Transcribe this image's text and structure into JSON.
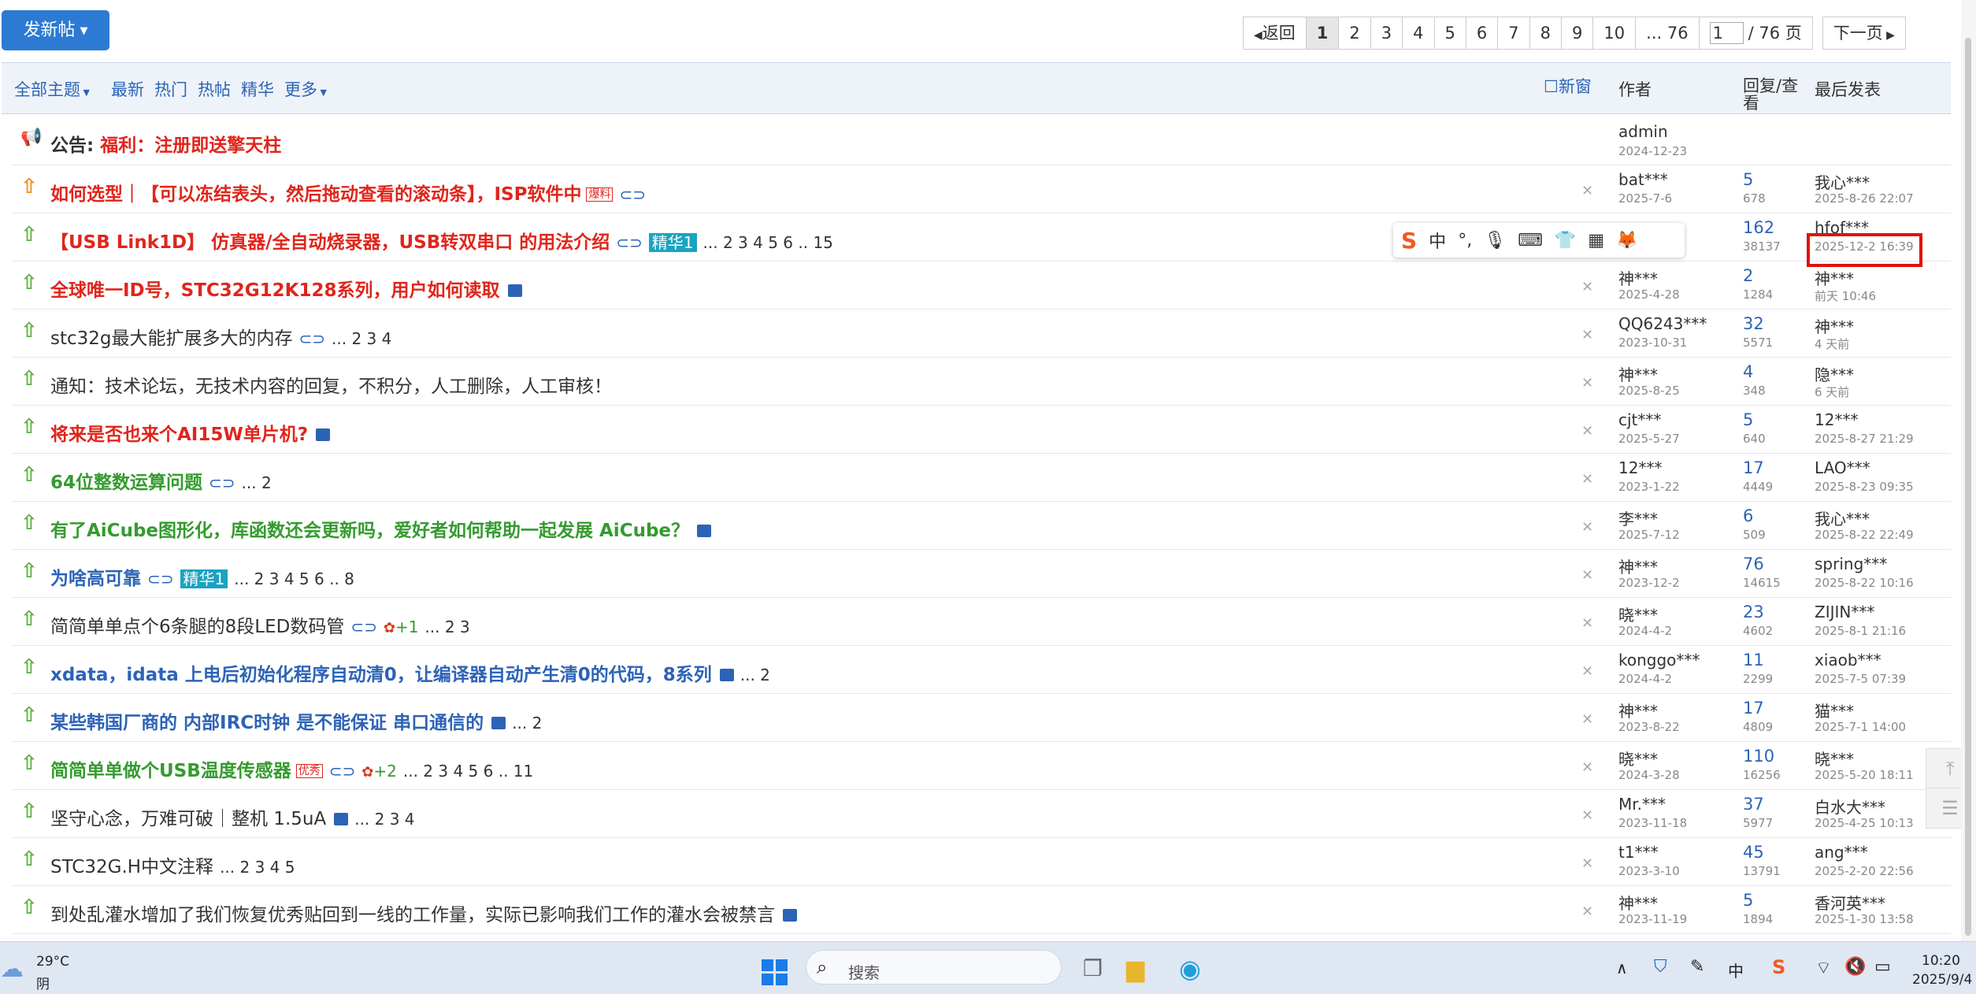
{
  "toolbar": {
    "post_label": "发新帖"
  },
  "pager": {
    "prev": "返回",
    "pages": [
      "1",
      "2",
      "3",
      "4",
      "5",
      "6",
      "7",
      "8",
      "9",
      "10",
      "... 76"
    ],
    "current_input": "1",
    "total": "/ 76 页",
    "next": "下一页"
  },
  "header": {
    "all_topics": "全部主题",
    "filters": [
      "最新",
      "热门",
      "热帖",
      "精华"
    ],
    "more": "更多",
    "new_window": "新窗",
    "col_author": "作者",
    "col_replies": "回复/查看",
    "col_last": "最后发表"
  },
  "announcement": {
    "prefix": "公告:",
    "title": "福利：注册即送擎天柱",
    "author": "admin",
    "date": "2024-12-23"
  },
  "rows": [
    {
      "title": "如何选型｜【可以冻结表头，然后拖动查看的滚动条】，ISP软件中",
      "badge": "爆料",
      "suffix": "",
      "author": "bat***",
      "date": "2025-7-6",
      "replies": "5",
      "views": "678",
      "last_user": "我心***",
      "last_time": "2025-8-26 22:07"
    },
    {
      "title": "【USB Link1D】 仿真器/全自动烧录器，USB转双串口 的用法介绍",
      "badge": "精华1",
      "suffix": "... 2  3  4  5  6 .. 15",
      "author": "",
      "date": "",
      "replies": "162",
      "views": "38137",
      "last_user": "hfof***",
      "last_time": "2025-12-2 16:39"
    },
    {
      "title": "全球唯一ID号，STC32G12K128系列，用户如何读取",
      "badge": "",
      "suffix": "",
      "author": "神***",
      "date": "2025-4-28",
      "replies": "2",
      "views": "1284",
      "last_user": "神***",
      "last_time": "前天 10:46"
    },
    {
      "title": "stc32g最大能扩展多大的内存",
      "badge": "",
      "suffix": "... 2  3  4",
      "author": "QQ6243***",
      "date": "2023-10-31",
      "replies": "32",
      "views": "5571",
      "last_user": "神***",
      "last_time": "4 天前"
    },
    {
      "title": "通知：技术论坛，无技术内容的回复，不积分，人工删除，人工审核！",
      "badge": "",
      "suffix": "",
      "author": "神***",
      "date": "2025-8-25",
      "replies": "4",
      "views": "348",
      "last_user": "隐***",
      "last_time": "6 天前"
    },
    {
      "title": "将来是否也来个AI15W单片机?",
      "badge": "",
      "suffix": "",
      "author": "cjt***",
      "date": "2025-5-27",
      "replies": "5",
      "views": "640",
      "last_user": "12***",
      "last_time": "2025-8-27 21:29"
    },
    {
      "title": "64位整数运算问题",
      "badge": "",
      "suffix": "... 2",
      "author": "12***",
      "date": "2023-1-22",
      "replies": "17",
      "views": "4449",
      "last_user": "LAO***",
      "last_time": "2025-8-23 09:35"
    },
    {
      "title": "有了AiCube图形化，库函数还会更新吗，爱好者如何帮助一起发展 AiCube？",
      "badge": "",
      "suffix": "",
      "author": "李***",
      "date": "2025-7-12",
      "replies": "6",
      "views": "509",
      "last_user": "我心***",
      "last_time": "2025-8-22 22:49"
    },
    {
      "title": "为啥高可靠",
      "badge": "精华1",
      "suffix": "... 2  3  4  5  6 .. 8",
      "author": "神***",
      "date": "2023-12-2",
      "replies": "76",
      "views": "14615",
      "last_user": "spring***",
      "last_time": "2025-8-22 10:16"
    },
    {
      "title": "简简单单点个6条腿的8段LED数码管",
      "badge": "",
      "suffix": "... 2  3",
      "author": "晓***",
      "date": "2024-4-2",
      "replies": "23",
      "views": "4602",
      "last_user": "ZIJIN***",
      "last_time": "2025-8-1 21:16"
    },
    {
      "title": "xdata，idata 上电后初始化程序自动清0，让编译器自动产生清0的代码，8系列",
      "badge": "",
      "suffix": "... 2",
      "author": "konggo***",
      "date": "2024-4-2",
      "replies": "11",
      "views": "2299",
      "last_user": "xiaob***",
      "last_time": "2025-7-5 07:39"
    },
    {
      "title": "某些韩国厂商的 内部IRC时钟 是不能保证 串口通信的",
      "badge": "",
      "suffix": "... 2",
      "author": "神***",
      "date": "2023-8-22",
      "replies": "17",
      "views": "4809",
      "last_user": "猫***",
      "last_time": "2025-7-1 14:00"
    },
    {
      "title": "简简单单做个USB温度传感器",
      "badge": "优秀",
      "suffix": "... 2  3  4  5  6 .. 11",
      "author": "晓***",
      "date": "2024-3-28",
      "replies": "110",
      "views": "16256",
      "last_user": "晓***",
      "last_time": "2025-5-20 18:11"
    },
    {
      "title": "坚守心念，万难可破｜整机 1.5uA",
      "badge": "",
      "suffix": "... 2  3  4",
      "author": "Mr.***",
      "date": "2023-11-18",
      "replies": "37",
      "views": "5977",
      "last_user": "白水大***",
      "last_time": "2025-4-25 10:13"
    },
    {
      "title": "STC32G.H中文注释",
      "badge": "",
      "suffix": "... 2  3  4  5",
      "author": "t1***",
      "date": "2023-3-10",
      "replies": "45",
      "views": "13791",
      "last_user": "ang***",
      "last_time": "2025-2-20 22:56"
    },
    {
      "title": "到处乱灌水增加了我们恢复优秀贴回到一线的工作量，实际已影响我们工作的灌水会被禁言",
      "badge": "",
      "suffix": "",
      "author": "神***",
      "date": "2023-11-19",
      "replies": "5",
      "views": "1894",
      "last_user": "香河英***",
      "last_time": "2025-1-30 13:58"
    }
  ],
  "plus_counts": [
    "+1",
    "+2"
  ],
  "ime": {
    "items": [
      "S",
      "中",
      "°,",
      "🎙",
      "⌨",
      "👕",
      "▦",
      "🦊"
    ]
  },
  "taskbar": {
    "temp": "29°C",
    "weather": "阴",
    "search_placeholder": "搜索",
    "ime_lang": "中",
    "time": "10:20",
    "date": "2025/9/4"
  },
  "colors": {
    "accent": "#2d7ad2",
    "title_red": "#e0251b",
    "title_green": "#349b2f",
    "title_blue": "#2d63b6",
    "highlight": "#e0120c"
  }
}
